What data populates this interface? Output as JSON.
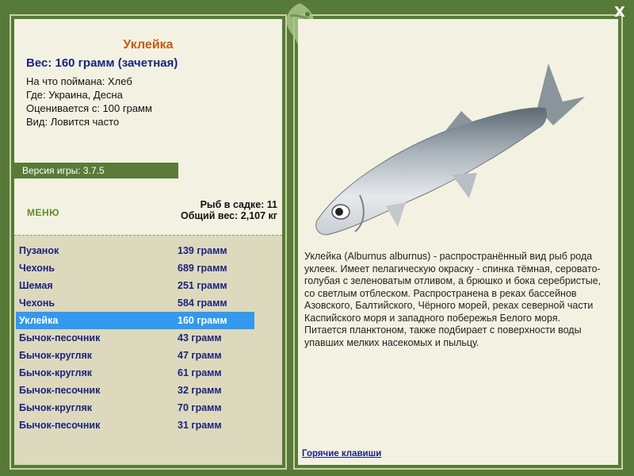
{
  "window": {
    "close_label": "X"
  },
  "catch": {
    "title": "Уклейка",
    "weight_line": "Вес: 160 грамм (зачетная)",
    "bait_line": "На что поймана: Хлеб",
    "place_line": "Где: Украина, Десна",
    "value_line": "Оценивается с: 100 грамм",
    "kind_line": "Вид: Ловится часто"
  },
  "version": {
    "label": "Версия игры: 3.7.5"
  },
  "menu": {
    "label": "МЕНЮ"
  },
  "stats": {
    "fish_count": "Рыб в садке: 11",
    "total_weight": "Общий вес: 2,107 кг"
  },
  "list": [
    {
      "name": "Пузанок",
      "weight": "139 грамм",
      "selected": false
    },
    {
      "name": "Чехонь",
      "weight": "689 грамм",
      "selected": false
    },
    {
      "name": "Шемая",
      "weight": "251 грамм",
      "selected": false
    },
    {
      "name": "Чехонь",
      "weight": "584 грамм",
      "selected": false
    },
    {
      "name": "Уклейка",
      "weight": "160 грамм",
      "selected": true
    },
    {
      "name": "Бычок-песочник",
      "weight": "43 грамм",
      "selected": false
    },
    {
      "name": "Бычок-кругляк",
      "weight": "47 грамм",
      "selected": false
    },
    {
      "name": "Бычок-кругляк",
      "weight": "61 грамм",
      "selected": false
    },
    {
      "name": "Бычок-песочник",
      "weight": "32 грамм",
      "selected": false
    },
    {
      "name": "Бычок-кругляк",
      "weight": "70 грамм",
      "selected": false
    },
    {
      "name": "Бычок-песочник",
      "weight": "31 грамм",
      "selected": false
    }
  ],
  "description": "Уклейка (Alburnus alburnus) - распространённый вид рыб рода уклеек. Имеет пелагическую окраску - спинка тёмная, серовато-голубая с зеленоватым отливом, а брюшко и бока серебристые, со светлым отблеском. Распространена в реках бассейнов Азовского, Балтийского, Чёрного морей, реках северной части Каспийского моря и западного побережья Белого моря. Питается планктоном, также подбирает с поверхности воды упавших мелких насекомых и пыльцу.",
  "hotkeys": {
    "label": "Горячие клавиши"
  },
  "icons": {
    "close": "close-icon",
    "logo": "fish-logo-icon",
    "fish": "fish-illustration"
  },
  "colors": {
    "frame": "#587a38",
    "panel": "#f3f2e2",
    "list_bg": "#dcd9bd",
    "selected": "#3399ee",
    "title": "#c55a11",
    "accent_text": "#1a237e"
  }
}
